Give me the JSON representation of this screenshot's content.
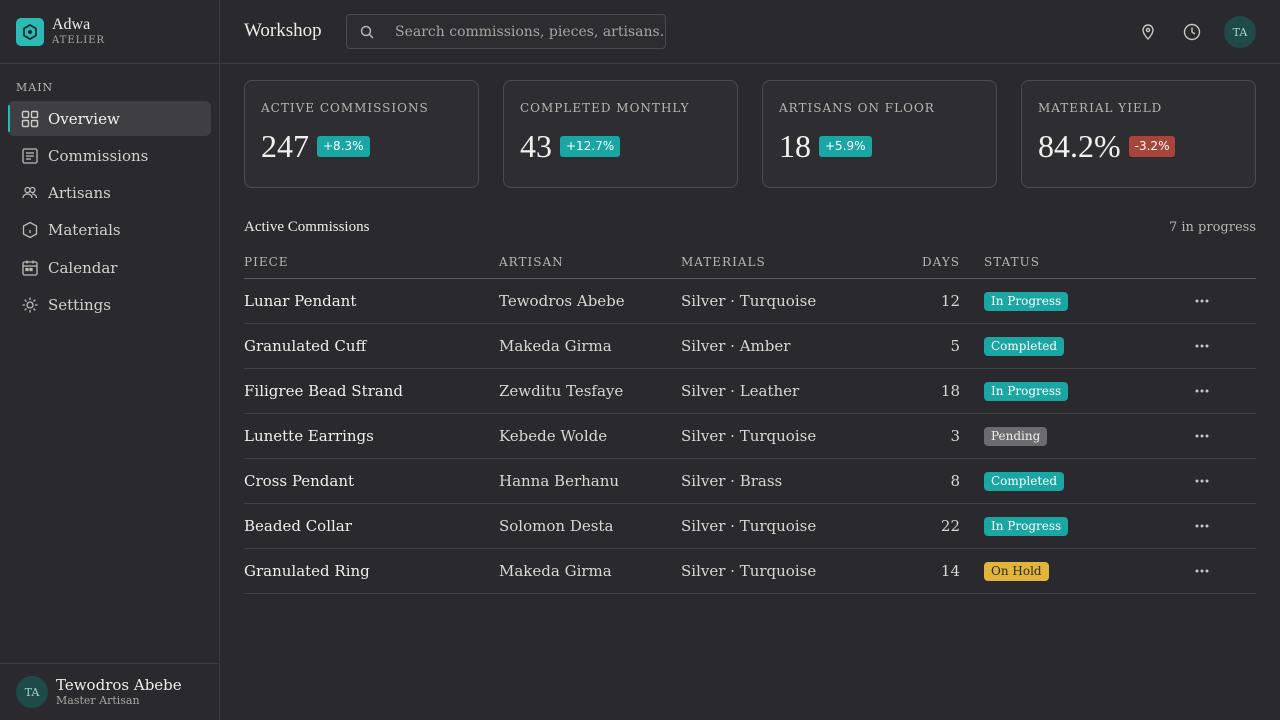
{
  "brand": {
    "name": "Adwa",
    "subtitle": "ATELIER",
    "logo_icon": "hexagon-logo-icon"
  },
  "sidebar": {
    "section_label": "MAIN",
    "items": [
      {
        "label": "Overview",
        "icon": "grid-icon",
        "active": true
      },
      {
        "label": "Commissions",
        "icon": "document-icon"
      },
      {
        "label": "Artisans",
        "icon": "users-icon"
      },
      {
        "label": "Materials",
        "icon": "hexagon-icon"
      },
      {
        "label": "Calendar",
        "icon": "calendar-icon"
      },
      {
        "label": "Settings",
        "icon": "gear-icon"
      }
    ]
  },
  "user": {
    "initials": "TA",
    "name": "Tewodros Abebe",
    "role": "Master Artisan"
  },
  "header": {
    "title": "Workshop",
    "search_placeholder": "Search commissions, pieces, artisans...",
    "avatar_initials": "TA"
  },
  "stats": [
    {
      "label": "ACTIVE COMMISSIONS",
      "value": "247",
      "change": "+8.3%",
      "trend": "up"
    },
    {
      "label": "COMPLETED MONTHLY",
      "value": "43",
      "change": "+12.7%",
      "trend": "up"
    },
    {
      "label": "ARTISANS ON FLOOR",
      "value": "18",
      "change": "+5.9%",
      "trend": "up"
    },
    {
      "label": "MATERIAL YIELD",
      "value": "84.2%",
      "change": "-3.2%",
      "trend": "down"
    }
  ],
  "table": {
    "title": "Active Commissions",
    "count_label": "7 in progress",
    "columns": [
      "PIECE",
      "ARTISAN",
      "MATERIALS",
      "DAYS",
      "STATUS"
    ],
    "rows": [
      {
        "piece": "Lunar Pendant",
        "artisan": "Tewodros Abebe",
        "materials": "Silver · Turquoise",
        "days": "12",
        "status": "In Progress"
      },
      {
        "piece": "Granulated Cuff",
        "artisan": "Makeda Girma",
        "materials": "Silver · Amber",
        "days": "5",
        "status": "Completed"
      },
      {
        "piece": "Filigree Bead Strand",
        "artisan": "Zewditu Tesfaye",
        "materials": "Silver · Leather",
        "days": "18",
        "status": "In Progress"
      },
      {
        "piece": "Lunette Earrings",
        "artisan": "Kebede Wolde",
        "materials": "Silver · Turquoise",
        "days": "3",
        "status": "Pending"
      },
      {
        "piece": "Cross Pendant",
        "artisan": "Hanna Berhanu",
        "materials": "Silver · Brass",
        "days": "8",
        "status": "Completed"
      },
      {
        "piece": "Beaded Collar",
        "artisan": "Solomon Desta",
        "materials": "Silver · Turquoise",
        "days": "22",
        "status": "In Progress"
      },
      {
        "piece": "Granulated Ring",
        "artisan": "Makeda Girma",
        "materials": "Silver · Turquoise",
        "days": "14",
        "status": "On Hold"
      }
    ]
  },
  "colors": {
    "accent": "#2bbab4",
    "background": "#2a2a2e",
    "positive": "#1aa6a3",
    "negative": "#a8453a",
    "on_hold": "#e0b53a",
    "pending": "#6b6b70"
  }
}
